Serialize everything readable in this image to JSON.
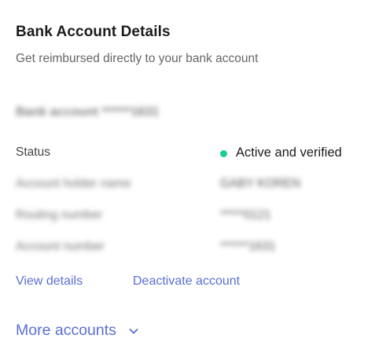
{
  "card": {
    "title": "Bank Account Details",
    "subtitle": "Get reimbursed directly to your bank account",
    "account_name": "Bank account ******1631"
  },
  "details": {
    "status_label": "Status",
    "status_value": "Active and verified",
    "status_color": "#19d18b",
    "holder_label": "Account holder name",
    "holder_value": "GABY KOREN",
    "routing_label": "Routing number",
    "routing_value": "*****0121",
    "account_label": "Account number",
    "account_value": "******1631"
  },
  "actions": {
    "view_details": "View details",
    "deactivate": "Deactivate account",
    "more_accounts": "More accounts"
  },
  "icons": {
    "more_chevron": "chevron-down-icon"
  },
  "colors": {
    "link": "#5a6fd1",
    "active_dot": "#19d18b"
  }
}
